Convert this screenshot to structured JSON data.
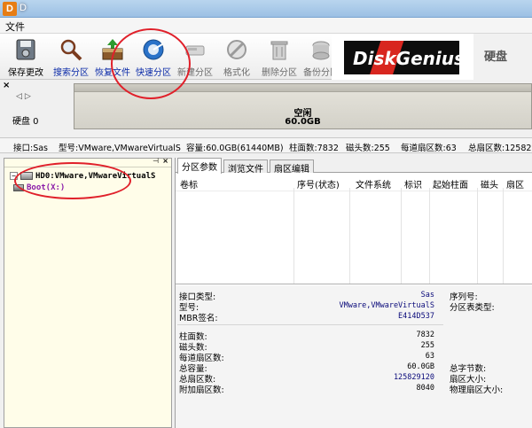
{
  "window": {
    "icon_letter": "D",
    "title": "D"
  },
  "menu": {
    "file": "文件"
  },
  "toolbar": {
    "buttons": [
      {
        "label": "保存更改",
        "icon": "save-icon",
        "color": "#333333"
      },
      {
        "label": "搜索分区",
        "icon": "magnifier-icon",
        "color": "#0a2aa8"
      },
      {
        "label": "恢复文件",
        "icon": "recover-box-icon",
        "color": "#0a2aa8"
      },
      {
        "label": "快速分区",
        "icon": "quick-partition-icon",
        "color": "#0a2aa8"
      },
      {
        "label": "新建分区",
        "icon": "new-partition-icon",
        "color": "#6b6b6b"
      },
      {
        "label": "格式化",
        "icon": "format-icon",
        "color": "#6b6b6b"
      },
      {
        "label": "删除分区",
        "icon": "trash-icon",
        "color": "#6b6b6b"
      },
      {
        "label": "备份分区",
        "icon": "backup-icon",
        "color": "#6b6b6b"
      }
    ]
  },
  "banner": {
    "text": "DiskGenius",
    "text_right": "硬盘"
  },
  "diskmap": {
    "close": "×",
    "disk_label": "硬盘 0",
    "partition_name": "空闲",
    "partition_size": "60.0GB"
  },
  "disk_info": {
    "interface": "接口:Sas",
    "model": "型号:VMware,VMwareVirtualS",
    "capacity": "容量:60.0GB(61440MB)",
    "cylinders": "柱面数:7832",
    "heads": "磁头数:255",
    "sectors_per_track": "每道扇区数:63",
    "total_sectors": "总扇区数:12582"
  },
  "tree": {
    "disk": "HD0:VMware,VMwareVirtualS",
    "partition": "Boot(X:)"
  },
  "tabs": [
    "分区参数",
    "浏览文件",
    "扇区编辑"
  ],
  "grid_headers": [
    "卷标",
    "序号(状态)",
    "文件系统",
    "标识",
    "起始柱面",
    "磁头",
    "扇区"
  ],
  "details": {
    "left": [
      {
        "label": "接口类型:",
        "value": "Sas"
      },
      {
        "label": "型号:",
        "value": "VMware,VMwareVirtualS"
      },
      {
        "label": "MBR签名:",
        "value": "E414D537"
      }
    ],
    "right_top": [
      {
        "label": "序列号:"
      },
      {
        "label": "分区表类型:"
      }
    ],
    "geometry": [
      {
        "label": "柱面数:",
        "value": "7832"
      },
      {
        "label": "磁头数:",
        "value": "255"
      },
      {
        "label": "每道扇区数:",
        "value": "63"
      },
      {
        "label": "总容量:",
        "value": "60.0GB"
      },
      {
        "label": "总扇区数:",
        "value": "125829120"
      },
      {
        "label": "附加扇区数:",
        "value": "8040"
      }
    ],
    "right_bottom": [
      {
        "label": "总字节数:"
      },
      {
        "label": "扇区大小:"
      },
      {
        "label": "物理扇区大小:"
      }
    ]
  },
  "annotation_color": "#e0202a"
}
